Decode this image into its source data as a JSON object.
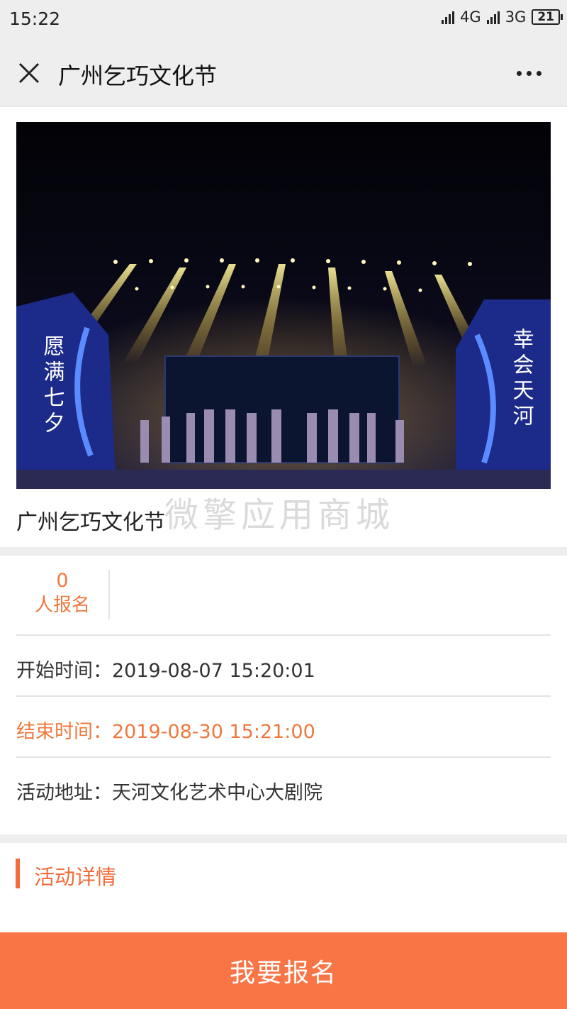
{
  "status_bar": {
    "time": "15:22",
    "network1": "4G",
    "network2": "3G",
    "battery": "21"
  },
  "nav": {
    "close_icon": "close-icon",
    "title": "广州乞巧文化节",
    "more_icon": "more-icon"
  },
  "banner": {
    "left_caption": "愿满七夕",
    "right_caption": "幸会天河"
  },
  "event": {
    "title": "广州乞巧文化节",
    "watermark": "微擎应用商城"
  },
  "signup": {
    "count": "0",
    "label": "人报名"
  },
  "info": {
    "start_time": "开始时间：2019-08-07 15:20:01",
    "end_time": "结束时间：2019-08-30 15:21:00",
    "address": "活动地址：天河文化艺术中心大剧院"
  },
  "detail": {
    "section_title": "活动详情"
  },
  "cta": {
    "label": "我要报名"
  },
  "colors": {
    "accent": "#f0783d",
    "button": "#fa7546",
    "background": "#eeeeee"
  }
}
